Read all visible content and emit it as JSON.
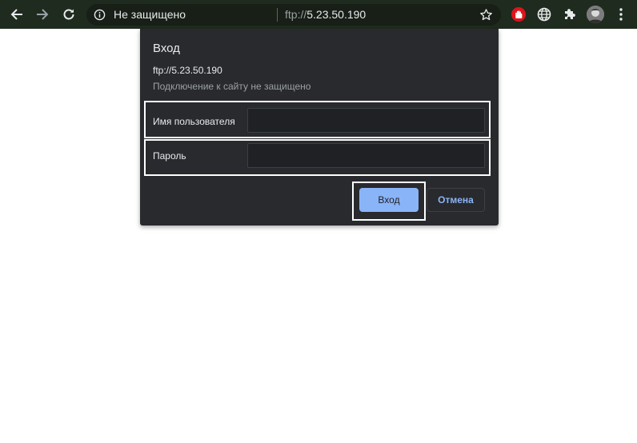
{
  "toolbar": {
    "security_label": "Не защищено",
    "url_scheme": "ftp://",
    "url_host": "5.23.50.190"
  },
  "dialog": {
    "title": "Вход",
    "site_url": "ftp://5.23.50.190",
    "warning": "Подключение к сайту не защищено",
    "username_label": "Имя пользователя",
    "username_value": "",
    "password_label": "Пароль",
    "password_value": "",
    "signin_label": "Вход",
    "cancel_label": "Отмена"
  },
  "colors": {
    "toolbar_bg": "#1f2b1e",
    "dialog_bg": "#292a2d",
    "accent": "#8ab4f8",
    "highlight": "#ffffff",
    "block_ext": "#e0131b"
  },
  "icons": [
    "back-arrow-icon",
    "forward-arrow-icon",
    "reload-icon",
    "info-icon",
    "bookmark-star-icon",
    "stop-hand-extension-icon",
    "globe-extension-icon",
    "puzzle-extensions-icon",
    "profile-avatar",
    "kebab-menu-icon"
  ]
}
